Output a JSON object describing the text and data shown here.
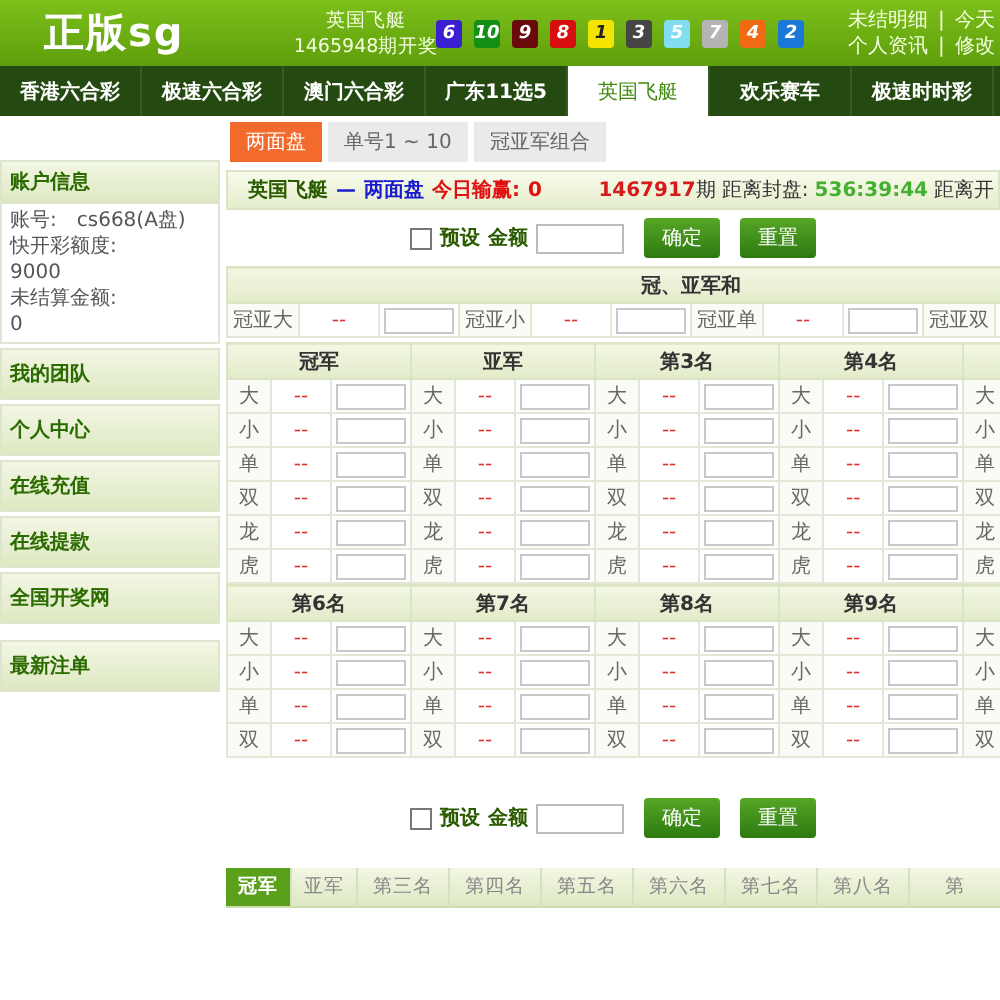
{
  "header": {
    "logo": "正版sg",
    "game": "英国飞艇",
    "issue": "1465948期开奖",
    "balls": [
      {
        "number": "6",
        "color": "#3a1fd0"
      },
      {
        "number": "10",
        "color": "#139013"
      },
      {
        "number": "9",
        "color": "#6b0a0a"
      },
      {
        "number": "8",
        "color": "#d80d0d"
      },
      {
        "number": "1",
        "color": "#f5e400"
      },
      {
        "number": "3",
        "color": "#454545"
      },
      {
        "number": "5",
        "color": "#80def0"
      },
      {
        "number": "7",
        "color": "#b4b4b4"
      },
      {
        "number": "4",
        "color": "#f06a14"
      },
      {
        "number": "2",
        "color": "#1c78d8"
      }
    ],
    "links": [
      {
        "left": "未结明细",
        "separator": "|",
        "right": "今天"
      },
      {
        "left": "个人资讯",
        "separator": "|",
        "right": "修改"
      }
    ]
  },
  "nav": [
    {
      "label": "香港六合彩",
      "selected": false
    },
    {
      "label": "极速六合彩",
      "selected": false
    },
    {
      "label": "澳门六合彩",
      "selected": false
    },
    {
      "label": "广东11选5",
      "selected": false
    },
    {
      "label": "英国飞艇",
      "selected": true
    },
    {
      "label": "欢乐赛车",
      "selected": false
    },
    {
      "label": "极速时时彩",
      "selected": false
    }
  ],
  "sidebar": {
    "account": {
      "title": "账户信息",
      "lines": [
        "账号:　cs668(A盘)",
        "快开彩额度:",
        "9000",
        "未结算金额:",
        "0"
      ]
    },
    "menu_groups": [
      [
        {
          "label": "我的团队"
        },
        {
          "label": "个人中心"
        },
        {
          "label": "在线充值"
        },
        {
          "label": "在线提款"
        },
        {
          "label": "全国开奖网"
        }
      ],
      [
        {
          "label": "最新注单"
        }
      ]
    ]
  },
  "subtabs": [
    {
      "label": "两面盘",
      "selected": true
    },
    {
      "label": "单号1 ~ 10",
      "selected": false
    },
    {
      "label": "冠亚军组合",
      "selected": false
    }
  ],
  "status": {
    "game": "英国飞艇",
    "dash": "—",
    "mode": "两面盘",
    "today_label": "今日输赢:",
    "today_value": "0",
    "period": "1467917",
    "period_unit": "期",
    "close_label": "距离封盘:",
    "close_time": "536:39:44",
    "draw_label": "距离开"
  },
  "bet_bars": [
    {
      "preset_label": "预设",
      "checked": false,
      "amount_label": "金额",
      "buttons": [
        "确定",
        "重置"
      ]
    },
    {
      "preset_label": "预设",
      "checked": false,
      "amount_label": "金额",
      "buttons": [
        "确定",
        "重置"
      ]
    }
  ],
  "sum": {
    "title": "冠、亚军和",
    "items": [
      {
        "label": "冠亚大",
        "odds": "--"
      },
      {
        "label": "冠亚小",
        "odds": "--"
      },
      {
        "label": "冠亚单",
        "odds": "--"
      },
      {
        "label": "冠亚双"
      }
    ]
  },
  "positions": [
    {
      "columns": [
        {
          "title": "冠军",
          "options": [
            {
              "label": "大",
              "odds": "--"
            },
            {
              "label": "小",
              "odds": "--"
            },
            {
              "label": "单",
              "odds": "--"
            },
            {
              "label": "双",
              "odds": "--"
            },
            {
              "label": "龙",
              "odds": "--"
            },
            {
              "label": "虎",
              "odds": "--"
            }
          ]
        },
        {
          "title": "亚军",
          "options": [
            {
              "label": "大",
              "odds": "--"
            },
            {
              "label": "小",
              "odds": "--"
            },
            {
              "label": "单",
              "odds": "--"
            },
            {
              "label": "双",
              "odds": "--"
            },
            {
              "label": "龙",
              "odds": "--"
            },
            {
              "label": "虎",
              "odds": "--"
            }
          ]
        },
        {
          "title": "第3名",
          "options": [
            {
              "label": "大",
              "odds": "--"
            },
            {
              "label": "小",
              "odds": "--"
            },
            {
              "label": "单",
              "odds": "--"
            },
            {
              "label": "双",
              "odds": "--"
            },
            {
              "label": "龙",
              "odds": "--"
            },
            {
              "label": "虎",
              "odds": "--"
            }
          ]
        },
        {
          "title": "第4名",
          "options": [
            {
              "label": "大",
              "odds": "--"
            },
            {
              "label": "小",
              "odds": "--"
            },
            {
              "label": "单",
              "odds": "--"
            },
            {
              "label": "双",
              "odds": "--"
            },
            {
              "label": "龙",
              "odds": "--"
            },
            {
              "label": "虎",
              "odds": "--"
            }
          ]
        },
        {
          "options": [
            {
              "label": "大"
            },
            {
              "label": "小"
            },
            {
              "label": "单"
            },
            {
              "label": "双"
            },
            {
              "label": "龙"
            },
            {
              "label": "虎"
            }
          ]
        }
      ]
    },
    {
      "columns": [
        {
          "title": "第6名",
          "options": [
            {
              "label": "大",
              "odds": "--"
            },
            {
              "label": "小",
              "odds": "--"
            },
            {
              "label": "单",
              "odds": "--"
            },
            {
              "label": "双",
              "odds": "--"
            }
          ]
        },
        {
          "title": "第7名",
          "options": [
            {
              "label": "大",
              "odds": "--"
            },
            {
              "label": "小",
              "odds": "--"
            },
            {
              "label": "单",
              "odds": "--"
            },
            {
              "label": "双",
              "odds": "--"
            }
          ]
        },
        {
          "title": "第8名",
          "options": [
            {
              "label": "大",
              "odds": "--"
            },
            {
              "label": "小",
              "odds": "--"
            },
            {
              "label": "单",
              "odds": "--"
            },
            {
              "label": "双",
              "odds": "--"
            }
          ]
        },
        {
          "title": "第9名",
          "options": [
            {
              "label": "大",
              "odds": "--"
            },
            {
              "label": "小",
              "odds": "--"
            },
            {
              "label": "单",
              "odds": "--"
            },
            {
              "label": "双",
              "odds": "--"
            }
          ]
        },
        {
          "options": [
            {
              "label": "大"
            },
            {
              "label": "小"
            },
            {
              "label": "单"
            },
            {
              "label": "双"
            }
          ]
        }
      ]
    }
  ],
  "bottom_tabs": [
    {
      "label": "冠军",
      "selected": true
    },
    {
      "label": "亚军",
      "selected": false
    },
    {
      "label": "第三名",
      "selected": false
    },
    {
      "label": "第四名",
      "selected": false
    },
    {
      "label": "第五名",
      "selected": false
    },
    {
      "label": "第六名",
      "selected": false
    },
    {
      "label": "第七名",
      "selected": false
    },
    {
      "label": "第八名",
      "selected": false
    },
    {
      "label": "第",
      "selected": false
    }
  ]
}
